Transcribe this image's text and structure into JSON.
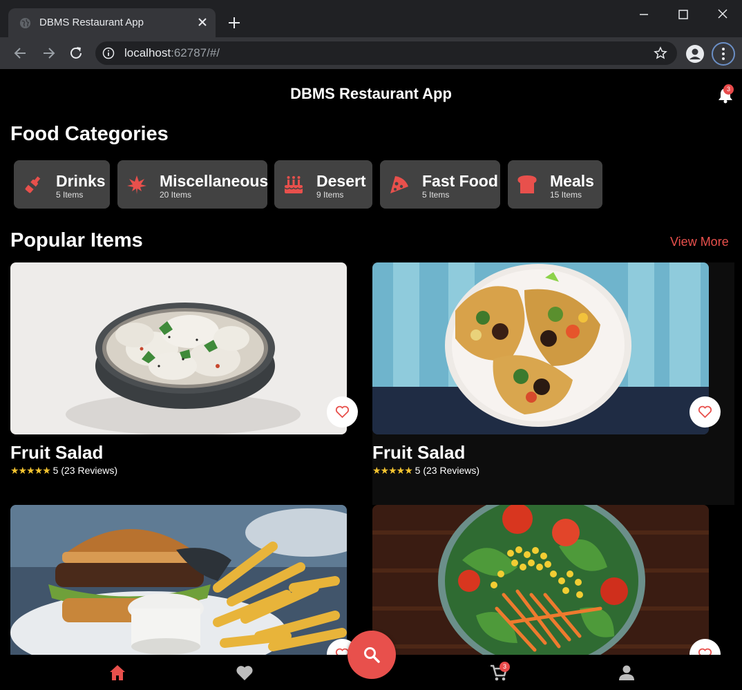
{
  "browser": {
    "tab_title": "DBMS Restaurant App",
    "url_host": "localhost",
    "url_rest": ":62787/#/"
  },
  "app": {
    "title": "DBMS Restaurant App",
    "notification_count": "3",
    "cart_count": "3",
    "accent_color": "#e8504c"
  },
  "categories_title": "Food Categories",
  "categories": [
    {
      "name": "Drinks",
      "count": "5 Items",
      "icon": "bottle-icon"
    },
    {
      "name": "Miscellaneous",
      "count": "20 Items",
      "icon": "leaf-icon"
    },
    {
      "name": "Desert",
      "count": "9 Items",
      "icon": "cake-icon"
    },
    {
      "name": "Fast Food",
      "count": "5 Items",
      "icon": "pizza-icon"
    },
    {
      "name": "Meals",
      "count": "15 Items",
      "icon": "bread-icon"
    }
  ],
  "popular_title": "Popular Items",
  "view_more": "View More",
  "items": [
    {
      "name": "Fruit Salad",
      "stars": "★★★★★",
      "rating": "5 (23 Reviews)"
    },
    {
      "name": "Fruit Salad",
      "stars": "★★★★★",
      "rating": "5 (23 Reviews)"
    }
  ]
}
